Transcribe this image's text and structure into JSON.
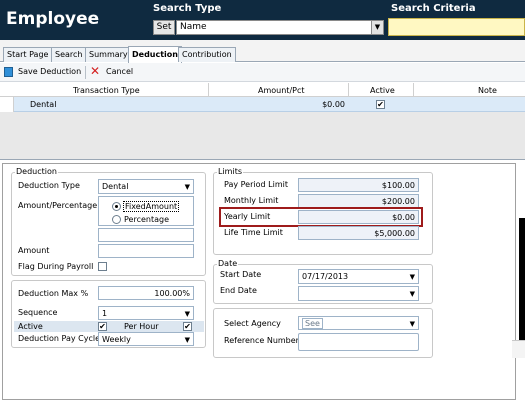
{
  "header": {
    "title": "Employee",
    "search_type_label": "Search Type",
    "search_criteria_label": "Search Criteria",
    "set_button": "Set",
    "search_type_value": "Name",
    "search_criteria_value": ""
  },
  "tabs": [
    {
      "label": "Start Page"
    },
    {
      "label": "Search"
    },
    {
      "label": "Summary"
    },
    {
      "label": "Deduction",
      "active": true
    },
    {
      "label": "Contribution"
    }
  ],
  "toolbar": {
    "save_label": "Save Deduction",
    "cancel_label": "Cancel"
  },
  "grid": {
    "columns": [
      "Transaction Type",
      "Amount/Pct",
      "Active",
      "Note"
    ],
    "rows": [
      {
        "transaction_type": "Dental",
        "amount": "$0.00",
        "active": true,
        "note": ""
      }
    ]
  },
  "deduction": {
    "legend": "Deduction",
    "type_label": "Deduction Type",
    "type_value": "Dental",
    "amount_pct_label": "Amount/Percentage",
    "fixed_amount_label": "FixedAmount",
    "percentage_label": "Percentage",
    "amount_label": "Amount",
    "amount_value": "",
    "flag_label": "Flag During Payroll",
    "flag_checked": false,
    "max_label": "Deduction Max %",
    "max_value": "100.00%",
    "sequence_label": "Sequence",
    "sequence_value": "1",
    "active_label": "Active",
    "active_checked": true,
    "per_hour_label": "Per Hour",
    "per_hour_checked": true,
    "pay_cycle_label": "Deduction Pay Cycle",
    "pay_cycle_value": "Weekly"
  },
  "limits": {
    "legend": "Limits",
    "pay_period_label": "Pay Period Limit",
    "pay_period_value": "$100.00",
    "monthly_label": "Monthly Limit",
    "monthly_value": "$200.00",
    "yearly_label": "Yearly Limit",
    "yearly_value": "$0.00",
    "lifetime_label": "Life Time Limit",
    "lifetime_value": "$5,000.00"
  },
  "date": {
    "legend": "Date",
    "start_label": "Start Date",
    "start_value": "07/17/2013",
    "end_label": "End Date",
    "end_value": ""
  },
  "agency": {
    "select_label": "Select Agency",
    "select_value": "See",
    "reference_label": "Reference Number",
    "reference_value": ""
  },
  "colors": {
    "header_bg": "#0f2a40",
    "header_text": "#ffffff",
    "criteria_bg": "#fff8c2",
    "grid_selected_row": "#dbeaf8",
    "highlight_border": "#9e1b1b"
  }
}
